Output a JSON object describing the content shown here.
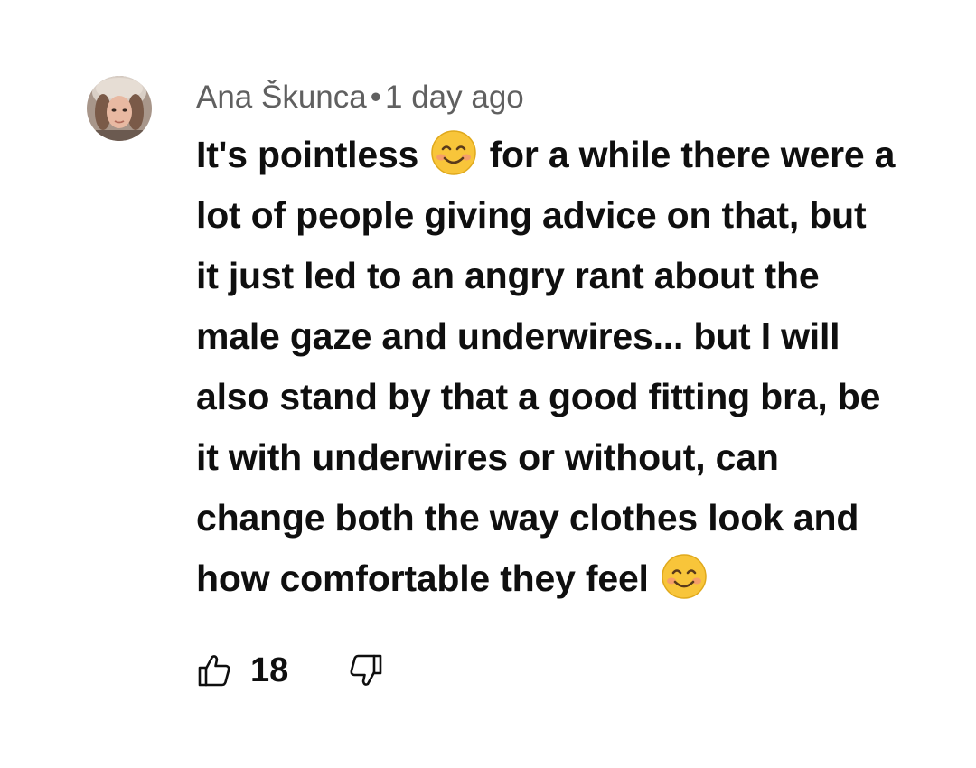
{
  "comment": {
    "author": "Ana Škunca",
    "separator": "•",
    "time": "1 day ago",
    "lines": [
      {
        "before": "It's pointless",
        "emoji": "smiling-face-with-smiling-eyes",
        "after": "for a while there were a"
      },
      {
        "text": "lot of people giving advice on that, but"
      },
      {
        "text": "it just led to an angry rant about the"
      },
      {
        "text": "male gaze and underwires... but I will"
      },
      {
        "text": "also stand by that a good fitting bra, be"
      },
      {
        "text": "it with underwires or without, can"
      },
      {
        "text": "change both the way clothes look and"
      },
      {
        "before": "how comfortable they feel",
        "emoji": "smiling-face-with-smiling-eyes"
      }
    ],
    "likes": "18"
  },
  "icons": {
    "like": "thumbs-up-icon",
    "dislike": "thumbs-down-icon",
    "avatar": "avatar"
  },
  "colors": {
    "meta_text": "#606060",
    "body_text": "#0f0f0f",
    "background": "#ffffff",
    "emoji_face": "#f8c53a"
  }
}
